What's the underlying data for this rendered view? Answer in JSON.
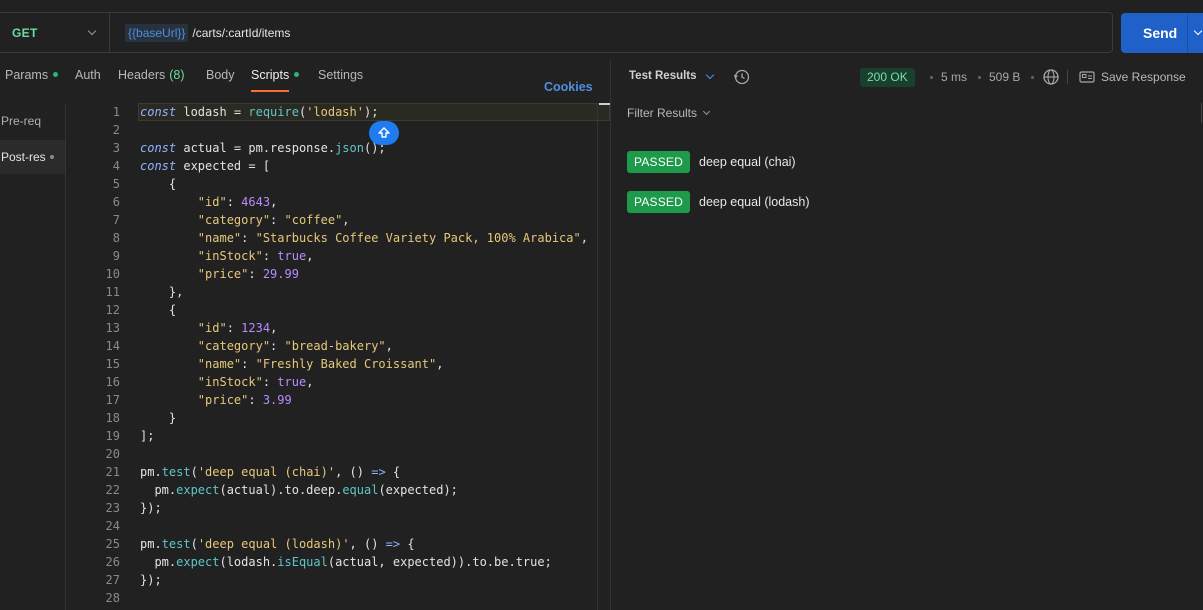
{
  "request": {
    "method": "GET",
    "url_variable": "{{baseUrl}}",
    "url_path": "/carts/:cartId/items",
    "send_label": "Send"
  },
  "tabs": [
    {
      "label": "Params",
      "dot": true
    },
    {
      "label": "Auth"
    },
    {
      "label": "Headers",
      "count": "(8)"
    },
    {
      "label": "Body"
    },
    {
      "label": "Scripts",
      "dot": true,
      "active": true
    },
    {
      "label": "Settings"
    }
  ],
  "cookies_label": "Cookies",
  "script_nav": [
    {
      "label": "Pre-req"
    },
    {
      "label": "Post-res",
      "active": true
    }
  ],
  "editor": {
    "lines": [
      [
        [
          "kw",
          "const"
        ],
        [
          "t",
          " lodash = "
        ],
        [
          "fn",
          "require"
        ],
        [
          "t",
          "("
        ],
        [
          "str",
          "'lodash'"
        ],
        [
          "t",
          ");"
        ]
      ],
      [],
      [
        [
          "kw",
          "const"
        ],
        [
          "t",
          " actual = pm.response."
        ],
        [
          "fn",
          "json"
        ],
        [
          "t",
          "();"
        ]
      ],
      [
        [
          "kw",
          "const"
        ],
        [
          "t",
          " expected = ["
        ]
      ],
      [
        [
          "t",
          "    {"
        ]
      ],
      [
        [
          "t",
          "        "
        ],
        [
          "str",
          "\"id\""
        ],
        [
          "t",
          ": "
        ],
        [
          "num",
          "4643"
        ],
        [
          "t",
          ","
        ]
      ],
      [
        [
          "t",
          "        "
        ],
        [
          "str",
          "\"category\""
        ],
        [
          "t",
          ": "
        ],
        [
          "str",
          "\"coffee\""
        ],
        [
          "t",
          ","
        ]
      ],
      [
        [
          "t",
          "        "
        ],
        [
          "str",
          "\"name\""
        ],
        [
          "t",
          ": "
        ],
        [
          "str",
          "\"Starbucks Coffee Variety Pack, 100% Arabica\""
        ],
        [
          "t",
          ","
        ]
      ],
      [
        [
          "t",
          "        "
        ],
        [
          "str",
          "\"inStock\""
        ],
        [
          "t",
          ": "
        ],
        [
          "bool",
          "true"
        ],
        [
          "t",
          ","
        ]
      ],
      [
        [
          "t",
          "        "
        ],
        [
          "str",
          "\"price\""
        ],
        [
          "t",
          ": "
        ],
        [
          "num",
          "29.99"
        ]
      ],
      [
        [
          "t",
          "    },"
        ]
      ],
      [
        [
          "t",
          "    {"
        ]
      ],
      [
        [
          "t",
          "        "
        ],
        [
          "str",
          "\"id\""
        ],
        [
          "t",
          ": "
        ],
        [
          "num",
          "1234"
        ],
        [
          "t",
          ","
        ]
      ],
      [
        [
          "t",
          "        "
        ],
        [
          "str",
          "\"category\""
        ],
        [
          "t",
          ": "
        ],
        [
          "str",
          "\"bread-bakery\""
        ],
        [
          "t",
          ","
        ]
      ],
      [
        [
          "t",
          "        "
        ],
        [
          "str",
          "\"name\""
        ],
        [
          "t",
          ": "
        ],
        [
          "str",
          "\"Freshly Baked Croissant\""
        ],
        [
          "t",
          ","
        ]
      ],
      [
        [
          "t",
          "        "
        ],
        [
          "str",
          "\"inStock\""
        ],
        [
          "t",
          ": "
        ],
        [
          "bool",
          "true"
        ],
        [
          "t",
          ","
        ]
      ],
      [
        [
          "t",
          "        "
        ],
        [
          "str",
          "\"price\""
        ],
        [
          "t",
          ": "
        ],
        [
          "num",
          "3.99"
        ]
      ],
      [
        [
          "t",
          "    }"
        ]
      ],
      [
        [
          "t",
          "];"
        ]
      ],
      [],
      [
        [
          "t",
          "pm."
        ],
        [
          "fn",
          "test"
        ],
        [
          "t",
          "("
        ],
        [
          "str",
          "'deep equal (chai)'"
        ],
        [
          "t",
          ", () "
        ],
        [
          "arr",
          "=>"
        ],
        [
          "t",
          " {"
        ]
      ],
      [
        [
          "t",
          "  pm."
        ],
        [
          "fn",
          "expect"
        ],
        [
          "t",
          "(actual).to.deep."
        ],
        [
          "fn",
          "equal"
        ],
        [
          "t",
          "(expected);"
        ]
      ],
      [
        [
          "t",
          "});"
        ]
      ],
      [],
      [
        [
          "t",
          "pm."
        ],
        [
          "fn",
          "test"
        ],
        [
          "t",
          "("
        ],
        [
          "str",
          "'deep equal (lodash)'"
        ],
        [
          "t",
          ", () "
        ],
        [
          "arr",
          "=>"
        ],
        [
          "t",
          " {"
        ]
      ],
      [
        [
          "t",
          "  pm."
        ],
        [
          "fn",
          "expect"
        ],
        [
          "t",
          "(lodash."
        ],
        [
          "fn",
          "isEqual"
        ],
        [
          "t",
          "(actual, expected)).to.be.true;"
        ]
      ],
      [
        [
          "t",
          "});"
        ]
      ],
      []
    ]
  },
  "response": {
    "header_label": "Test Results",
    "status": "200 OK",
    "time": "5 ms",
    "size": "509 B",
    "save_label": "Save Response",
    "filter_label": "Filter Results",
    "results": [
      {
        "status": "PASSED",
        "name": "deep equal (chai)"
      },
      {
        "status": "PASSED",
        "name": "deep equal (lodash)"
      }
    ]
  },
  "colors": {
    "accent": "#ff6c37",
    "send": "#1f61c9",
    "passed": "#1d9a4a",
    "status_ok": "#7ddca5"
  }
}
